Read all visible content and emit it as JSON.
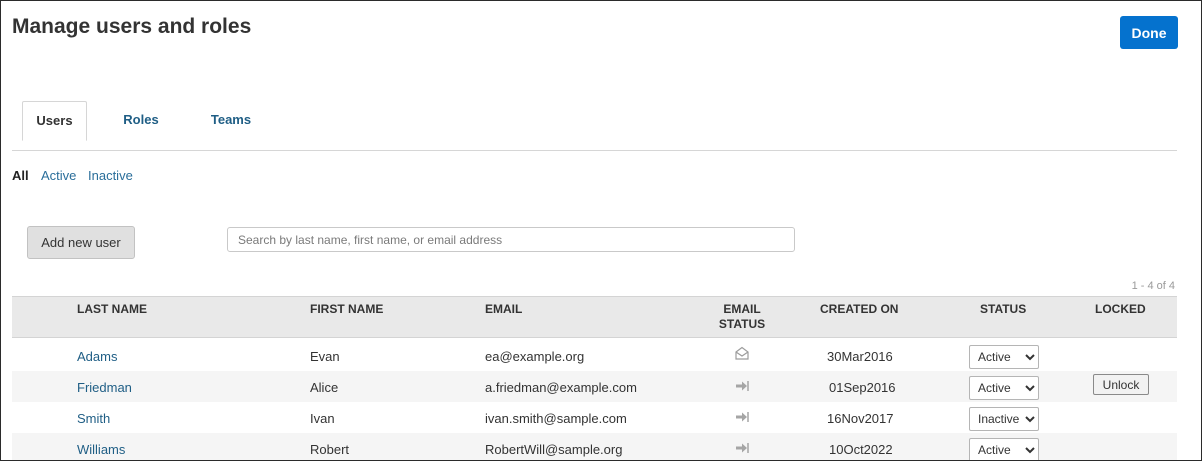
{
  "header": {
    "title": "Manage users and roles",
    "done_label": "Done"
  },
  "tabs": [
    {
      "label": "Users",
      "active": true
    },
    {
      "label": "Roles",
      "active": false
    },
    {
      "label": "Teams",
      "active": false
    }
  ],
  "filters": {
    "all": "All",
    "active": "Active",
    "inactive": "Inactive",
    "selected": "All"
  },
  "toolbar": {
    "add_user_label": "Add new user",
    "search_placeholder": "Search by last name, first name, or email address",
    "search_value": ""
  },
  "pagination": {
    "text": "1 - 4 of 4"
  },
  "table": {
    "columns": {
      "last_name": "LAST NAME",
      "first_name": "FIRST NAME",
      "email": "EMAIL",
      "email_status_1": "EMAIL",
      "email_status_2": "STATUS",
      "created_on": "CREATED ON",
      "status": "STATUS",
      "locked": "LOCKED"
    },
    "status_options": [
      "Active",
      "Inactive"
    ],
    "rows": [
      {
        "last_name": "Adams",
        "first_name": "Evan",
        "email": "ea@example.org",
        "email_status_icon": "envelope-open-icon",
        "created_on": "30Mar2016",
        "status": "Active",
        "unlock_label": ""
      },
      {
        "last_name": "Friedman",
        "first_name": "Alice",
        "email": "a.friedman@example.com",
        "email_status_icon": "sign-in-icon",
        "created_on": "01Sep2016",
        "status": "Active",
        "unlock_label": "Unlock"
      },
      {
        "last_name": "Smith",
        "first_name": "Ivan",
        "email": "ivan.smith@sample.com",
        "email_status_icon": "sign-in-icon",
        "created_on": "16Nov2017",
        "status": "Inactive",
        "unlock_label": ""
      },
      {
        "last_name": "Williams",
        "first_name": "Robert",
        "email": "RobertWill@sample.org",
        "email_status_icon": "sign-in-icon",
        "created_on": "10Oct2022",
        "status": "Active",
        "unlock_label": ""
      }
    ]
  },
  "colors": {
    "primary": "#0572ce",
    "link": "#1f5e85",
    "header_bg": "#e9e9e9",
    "row_alt": "#f5f5f5"
  }
}
